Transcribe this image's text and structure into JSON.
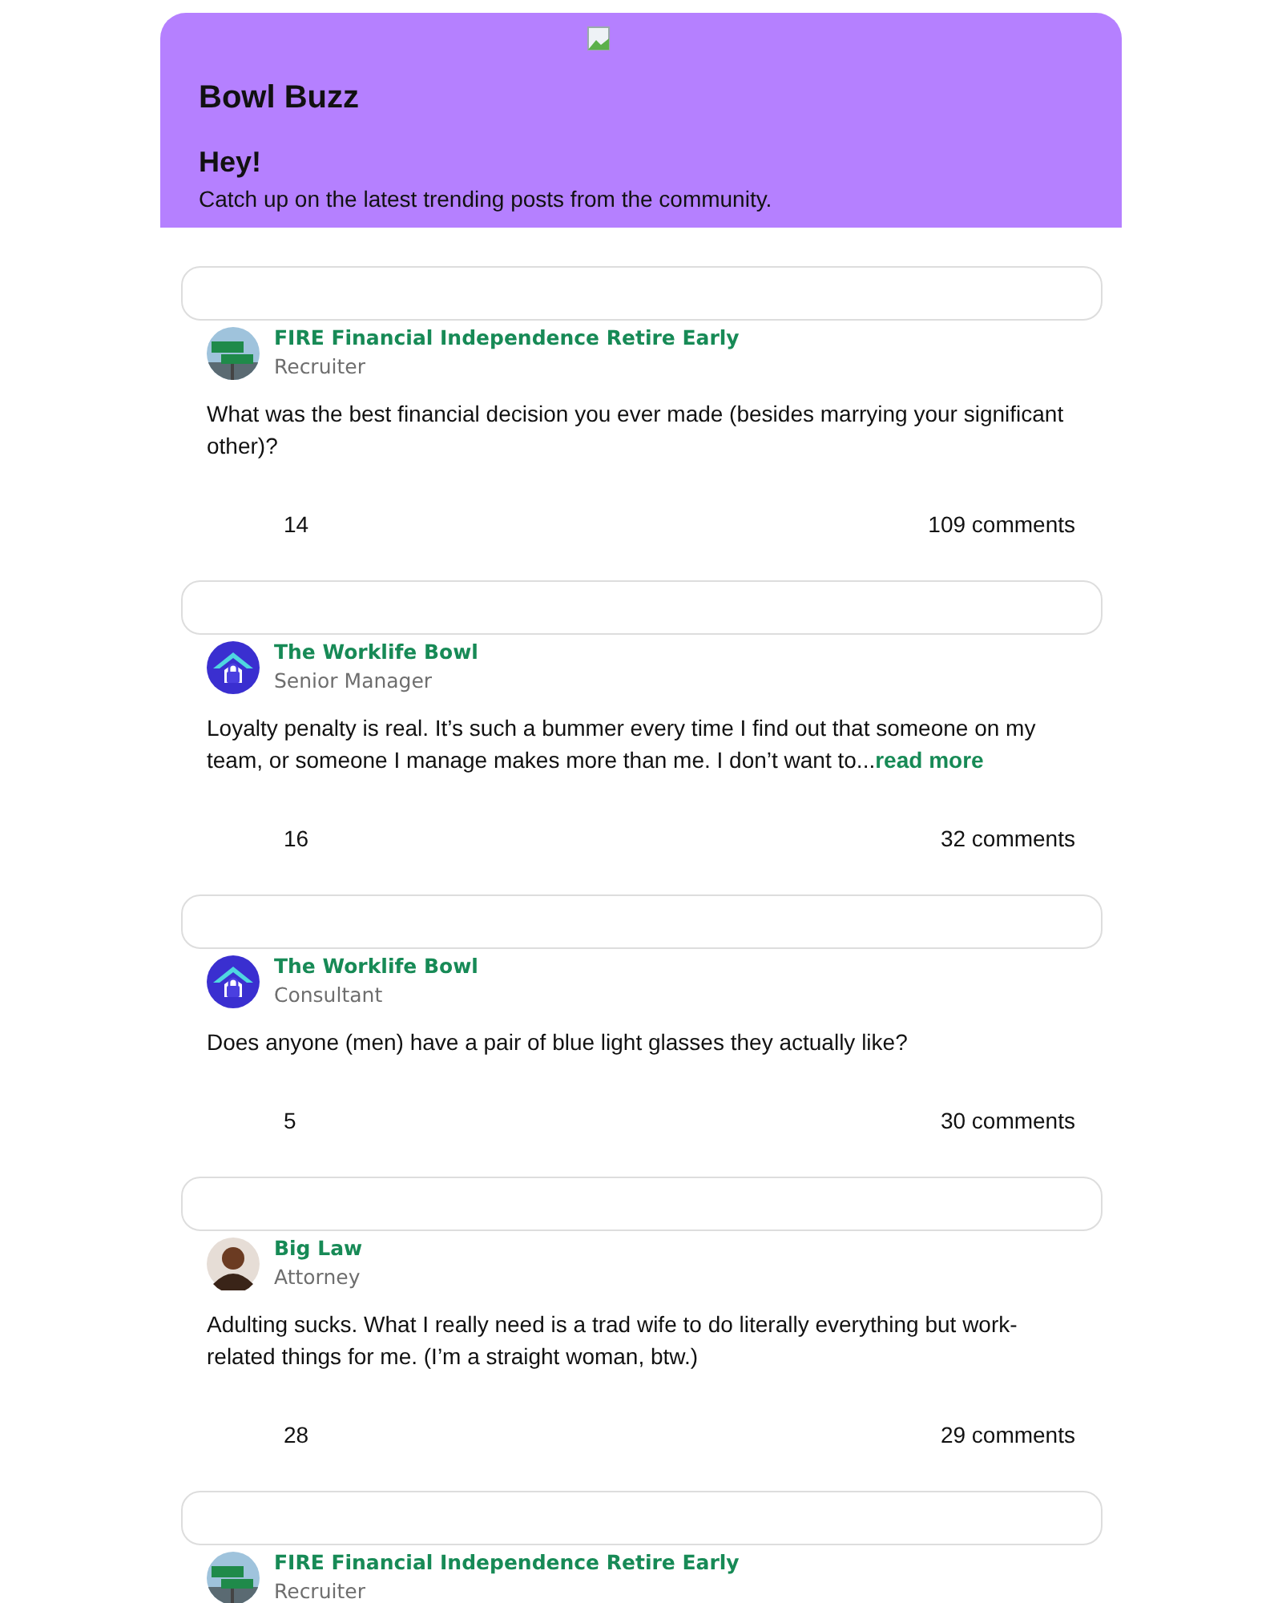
{
  "header": {
    "title": "Bowl Buzz",
    "greeting": "Hey!",
    "subtitle": "Catch up on the latest trending posts from the community."
  },
  "posts": [
    {
      "bowl": "FIRE Financial Independence Retire Early",
      "role": "Recruiter",
      "text": "What was the best financial decision you ever made (besides marrying your significant other)?",
      "likes": "14",
      "comments": "109 comments"
    },
    {
      "avatar": {
        "kind": "house"
      },
      "bowl": "The Worklife Bowl",
      "role": "Senior Manager",
      "text": "Loyalty penalty is real. It’s such a bummer every time I find out that someone on my team, or someone I manage makes more than me. I don’t want to...",
      "more": "read more",
      "likes": "16",
      "comments": "32 comments"
    },
    {
      "avatar": {
        "kind": "house"
      },
      "bowl": "The Worklife Bowl",
      "role": "Consultant",
      "text": "Does anyone (men) have a pair of blue light glasses they actually like?",
      "likes": "5",
      "comments": "30 comments"
    },
    {
      "avatar": {
        "kind": "person"
      },
      "bowl": "Big Law",
      "role": "Attorney",
      "text": "Adulting sucks. What I really need is a trad wife to do literally everything but work-related things for me. (I’m a straight woman, btw.)",
      "likes": "28",
      "comments": "29 comments"
    },
    {
      "bowl": "FIRE Financial Independence Retire Early",
      "role": "Recruiter"
    }
  ]
}
